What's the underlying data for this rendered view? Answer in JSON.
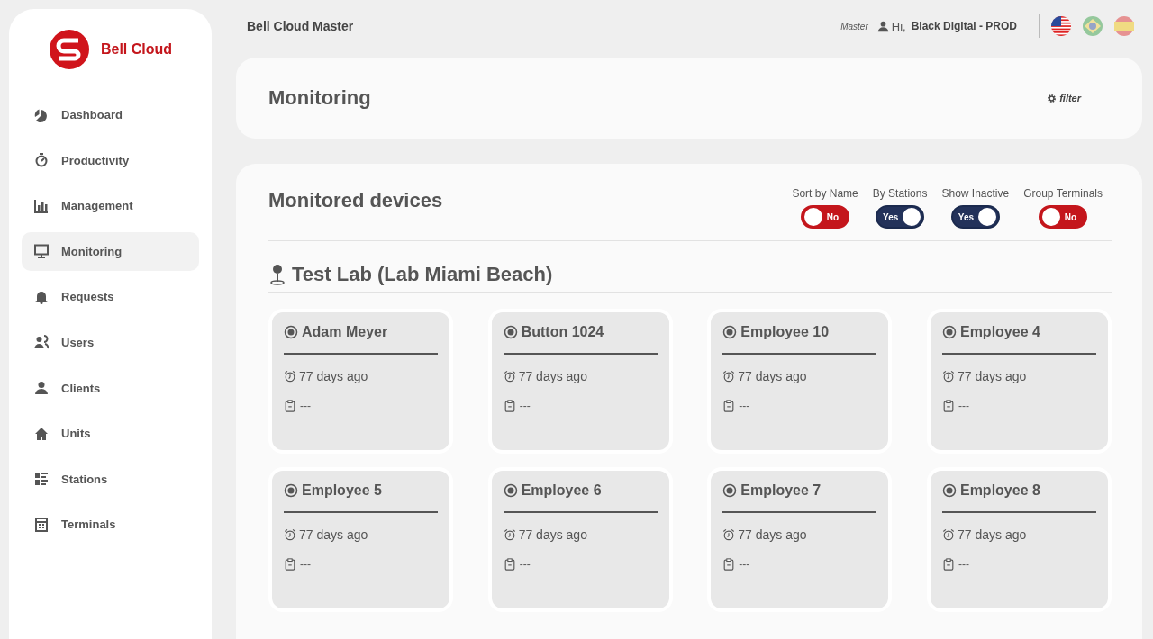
{
  "sidebar": {
    "brand": "Bell Cloud",
    "items": [
      {
        "label": "Dashboard",
        "selected": false
      },
      {
        "label": "Productivity",
        "selected": false
      },
      {
        "label": "Management",
        "selected": false
      },
      {
        "label": "Monitoring",
        "selected": true
      },
      {
        "label": "Requests",
        "selected": false
      },
      {
        "label": "Users",
        "selected": false
      },
      {
        "label": "Clients",
        "selected": false
      },
      {
        "label": "Units",
        "selected": false
      },
      {
        "label": "Stations",
        "selected": false
      },
      {
        "label": "Terminals",
        "selected": false
      }
    ]
  },
  "header": {
    "title": "Bell Cloud Master",
    "role": "Master",
    "greeting": "Hi,",
    "account": "Black Digital - PROD",
    "languages": [
      {
        "kind": "us",
        "selected": true
      },
      {
        "kind": "br",
        "selected": false
      },
      {
        "kind": "es",
        "selected": false
      }
    ]
  },
  "page": {
    "title": "Monitoring",
    "filter": "filter"
  },
  "devices_panel": {
    "title": "Monitored devices",
    "toggles": [
      {
        "label": "Sort by Name",
        "on": false,
        "state_text": "No"
      },
      {
        "label": "By Stations",
        "on": true,
        "state_text": "Yes"
      },
      {
        "label": "Show Inactive",
        "on": true,
        "state_text": "Yes"
      },
      {
        "label": "Group Terminals",
        "on": false,
        "state_text": "No"
      }
    ],
    "location": "Test Lab (Lab Miami Beach)",
    "devices": [
      {
        "name": "Adam Meyer",
        "last_seen": "77 days ago",
        "note": "---"
      },
      {
        "name": "Button 1024",
        "last_seen": "77 days ago",
        "note": "---"
      },
      {
        "name": "Employee 10",
        "last_seen": "77 days ago",
        "note": "---"
      },
      {
        "name": "Employee 4",
        "last_seen": "77 days ago",
        "note": "---"
      },
      {
        "name": "Employee 5",
        "last_seen": "77 days ago",
        "note": "---"
      },
      {
        "name": "Employee 6",
        "last_seen": "77 days ago",
        "note": "---"
      },
      {
        "name": "Employee 7",
        "last_seen": "77 days ago",
        "note": "---"
      },
      {
        "name": "Employee 8",
        "last_seen": "77 days ago",
        "note": "---"
      }
    ]
  }
}
